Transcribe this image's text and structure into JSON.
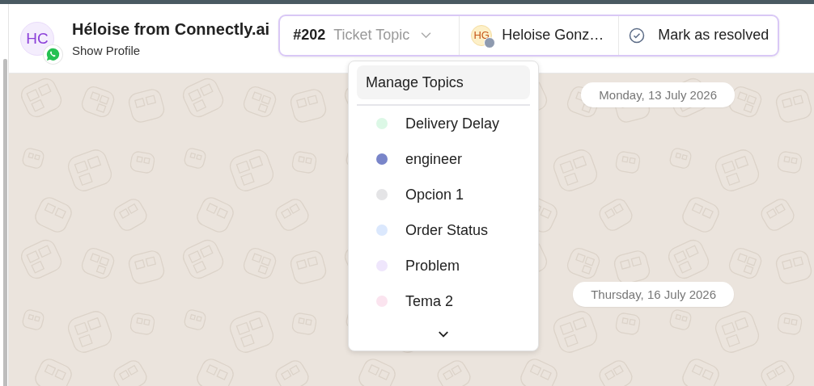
{
  "contact": {
    "initials": "HC",
    "name": "Héloise from Connectly.ai",
    "link": "Show Profile"
  },
  "ticket": {
    "number": "#202",
    "topic_placeholder": "Ticket Topic"
  },
  "assignee": {
    "initials": "HG",
    "name": "Heloise Gonz…"
  },
  "resolve_button": "Mark as resolved",
  "topic_menu": {
    "manage": "Manage Topics",
    "topics": [
      {
        "label": "Delivery Delay",
        "color": "#dcf8e6"
      },
      {
        "label": "engineer",
        "color": "#7985c9"
      },
      {
        "label": "Opcion 1",
        "color": "#e4e4e6"
      },
      {
        "label": "Order Status",
        "color": "#dbe8fd"
      },
      {
        "label": "Problem",
        "color": "#efe6fc"
      },
      {
        "label": "Tema 2",
        "color": "#fbe4ef"
      }
    ]
  },
  "dates": [
    "Monday, 13 July 2026",
    "Thursday, 16 July 2026"
  ]
}
